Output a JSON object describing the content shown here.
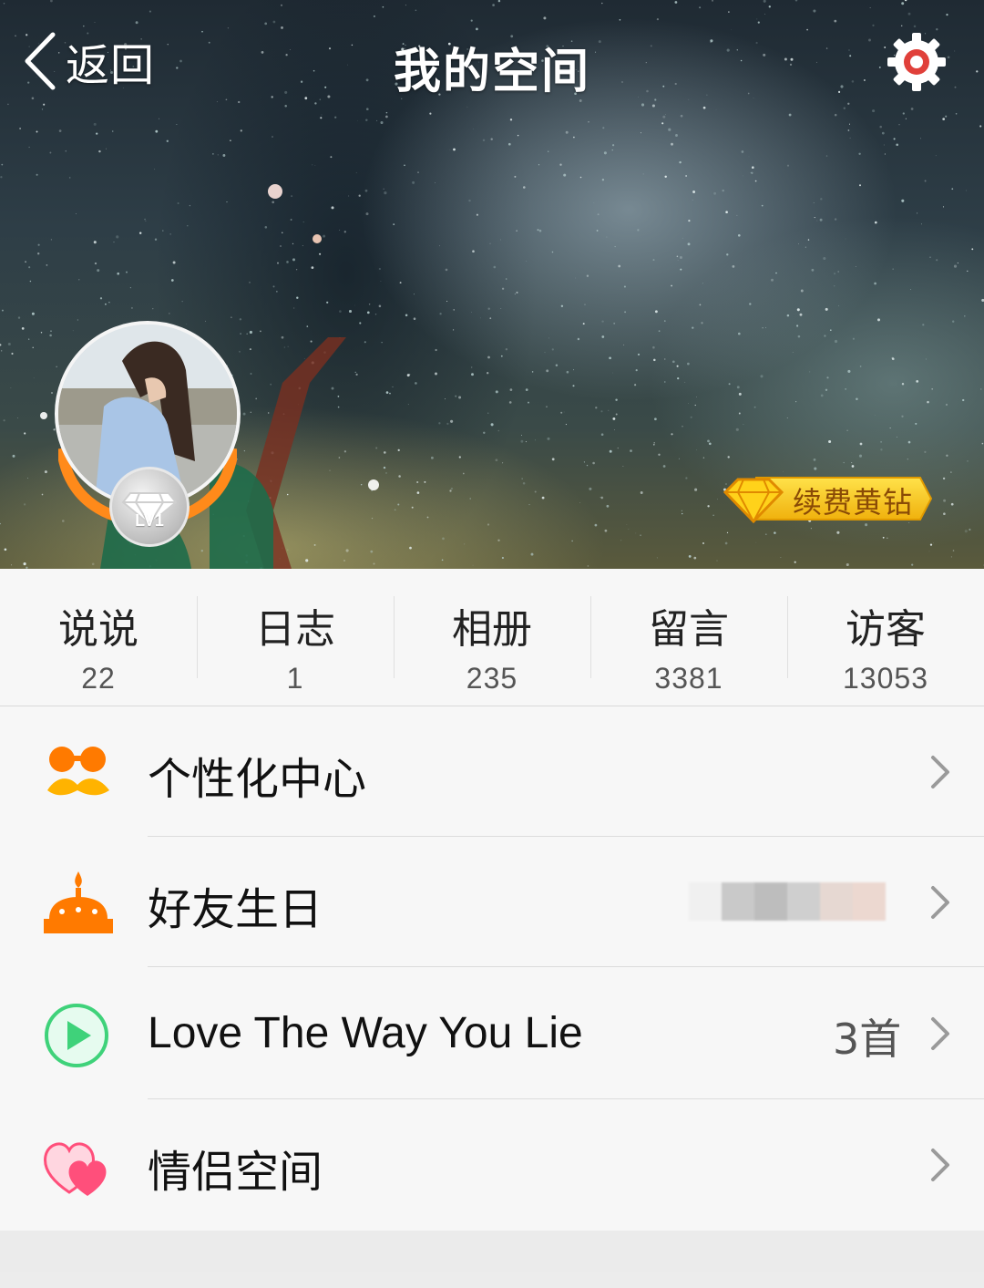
{
  "nav": {
    "back_label": "返回",
    "title": "我的空间",
    "settings_icon": "gear-icon"
  },
  "profile": {
    "level_badge": "LV1",
    "vip_label": "续费黄钻"
  },
  "stats": [
    {
      "label": "说说",
      "value": "22"
    },
    {
      "label": "日志",
      "value": "1"
    },
    {
      "label": "相册",
      "value": "235"
    },
    {
      "label": "留言",
      "value": "3381"
    },
    {
      "label": "访客",
      "value": "13053"
    }
  ],
  "menu": [
    {
      "label": "个性化中心",
      "icon": "mustache-glasses-icon"
    },
    {
      "label": "好友生日",
      "icon": "birthday-cake-icon"
    },
    {
      "label": "Love The Way You Lie",
      "icon": "play-icon",
      "extra": "3首"
    },
    {
      "label": "情侣空间",
      "icon": "hearts-icon"
    }
  ],
  "colors": {
    "accent_orange": "#ff7a00",
    "play_green": "#3fd27a",
    "heart_pink": "#ff4f7b",
    "vip_gold": "#f6c21a"
  }
}
